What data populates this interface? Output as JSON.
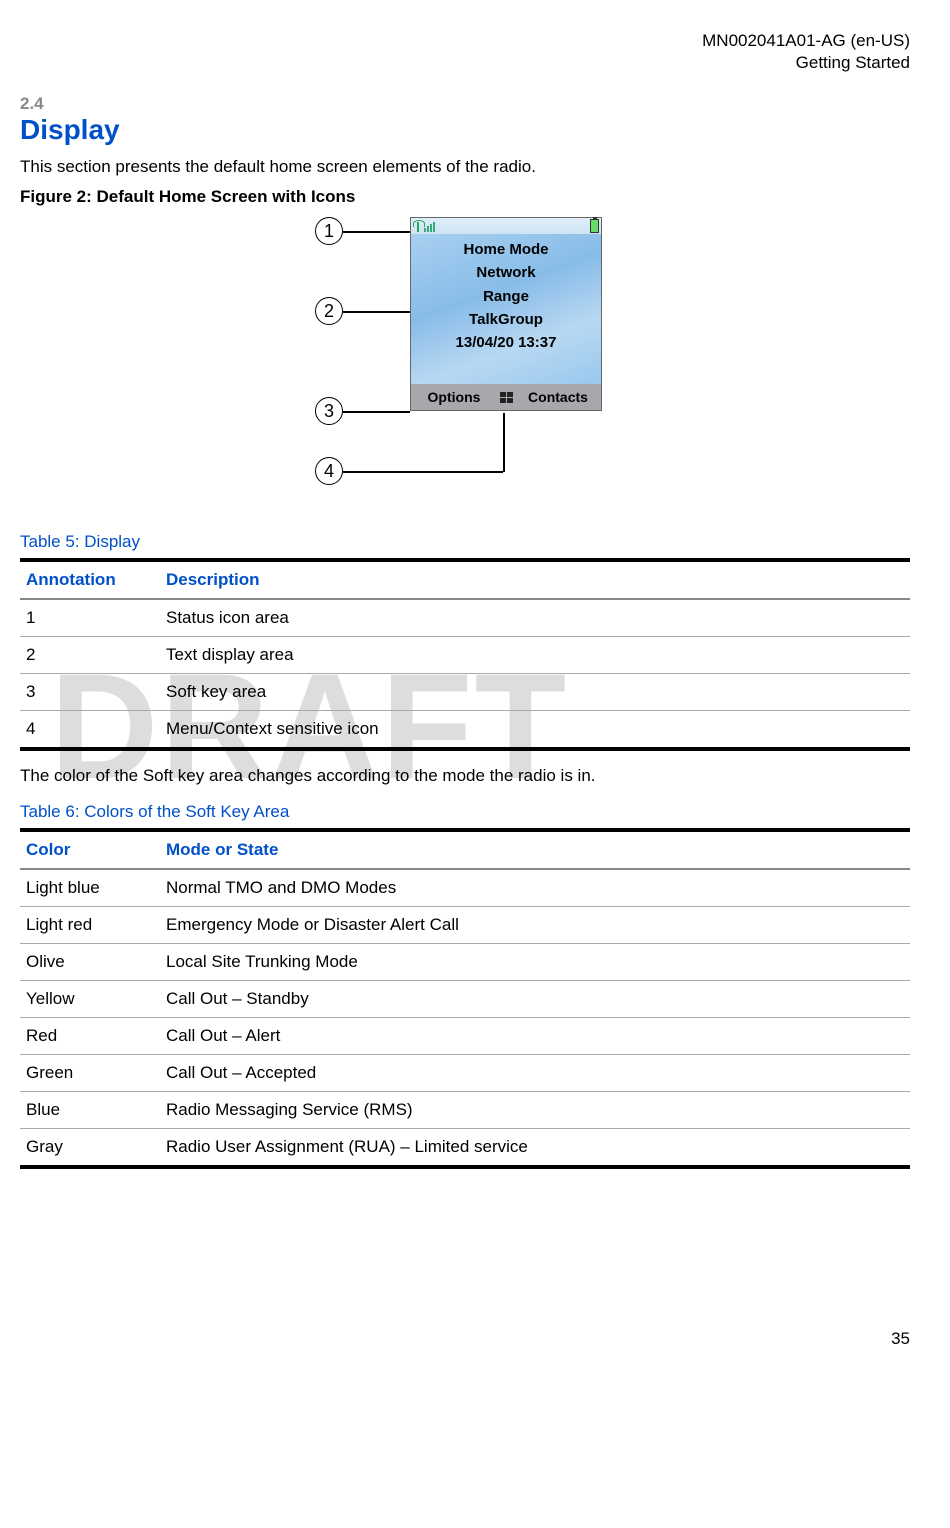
{
  "header": {
    "doc_id": "MN002041A01-AG (en-US)",
    "chapter": "Getting Started"
  },
  "section": {
    "number": "2.4",
    "title": "Display",
    "intro": "This section presents the default home screen elements of the radio.",
    "figure_caption": "Figure 2: Default Home Screen with Icons"
  },
  "phone": {
    "lines": {
      "l1": "Home Mode",
      "l2": "Network",
      "l3": "Range",
      "l4": "TalkGroup",
      "l5": "13/04/20 13:37"
    },
    "soft_left": "Options",
    "soft_right": "Contacts"
  },
  "callouts": {
    "c1": "1",
    "c2": "2",
    "c3": "3",
    "c4": "4"
  },
  "table5": {
    "title": "Table 5: Display",
    "head": {
      "h1": "Annotation",
      "h2": "Description"
    },
    "rows": [
      {
        "a": "1",
        "b": "Status icon area"
      },
      {
        "a": "2",
        "b": "Text display area"
      },
      {
        "a": "3",
        "b": "Soft key area"
      },
      {
        "a": "4",
        "b": "Menu/Context sensitive icon"
      }
    ]
  },
  "mid_para": "The color of the Soft key area changes according to the mode the radio is in.",
  "table6": {
    "title": "Table 6: Colors of the Soft Key Area",
    "head": {
      "h1": "Color",
      "h2": "Mode or State"
    },
    "rows": [
      {
        "a": "Light blue",
        "b": "Normal TMO and DMO Modes"
      },
      {
        "a": "Light red",
        "b": "Emergency Mode or Disaster Alert Call"
      },
      {
        "a": "Olive",
        "b": "Local Site Trunking Mode"
      },
      {
        "a": "Yellow",
        "b": "Call Out – Standby"
      },
      {
        "a": "Red",
        "b": "Call Out – Alert"
      },
      {
        "a": "Green",
        "b": "Call Out – Accepted"
      },
      {
        "a": "Blue",
        "b": "Radio Messaging Service (RMS)"
      },
      {
        "a": "Gray",
        "b": "Radio User Assignment (RUA) – Limited service"
      }
    ]
  },
  "watermark": "DRAFT",
  "page_number": "35"
}
